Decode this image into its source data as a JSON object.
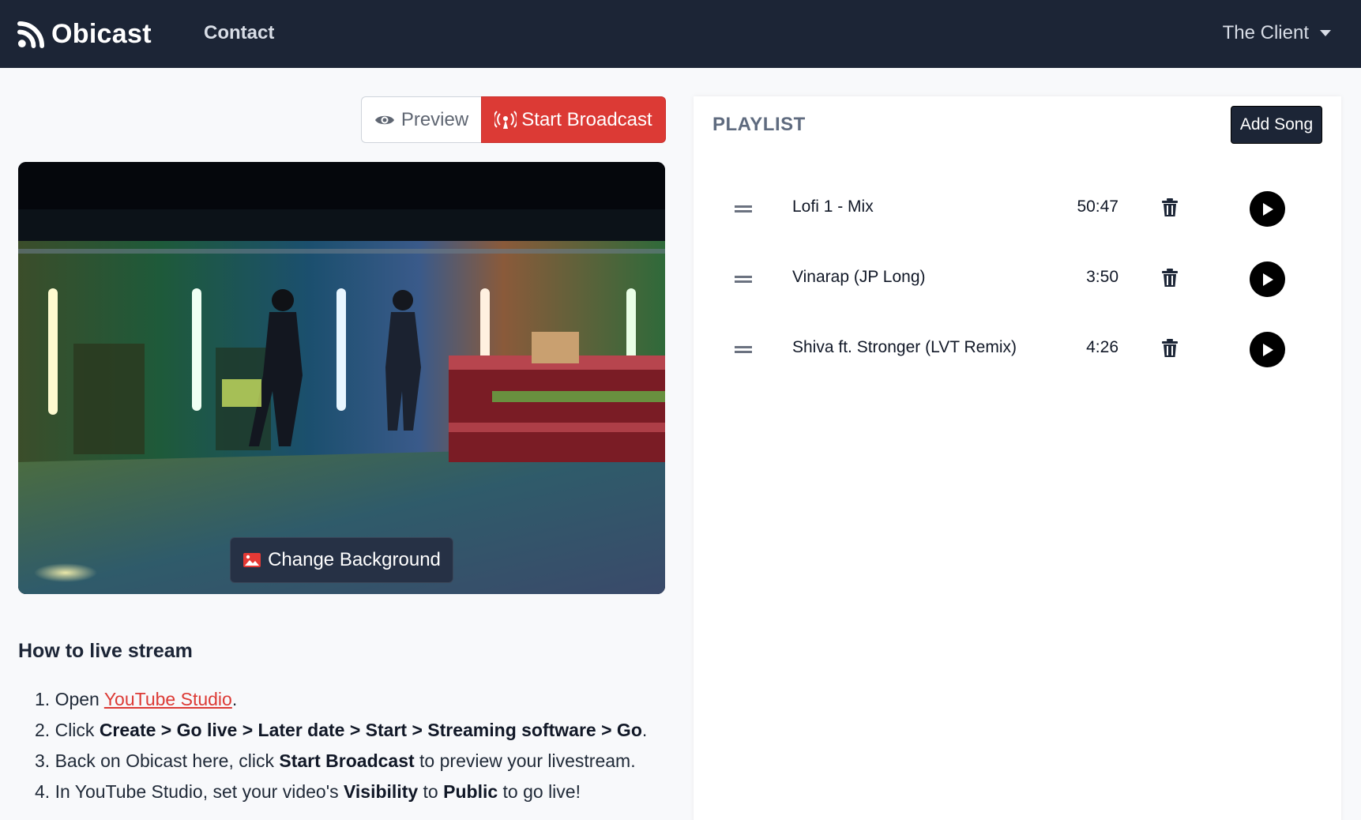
{
  "navbar": {
    "brand": "Obicast",
    "contact_link": "Contact",
    "user_menu": "The Client"
  },
  "controls": {
    "preview_label": "Preview",
    "broadcast_label": "Start Broadcast"
  },
  "background": {
    "change_label": "Change Background"
  },
  "howto": {
    "title": "How to live stream",
    "steps": [
      {
        "num": "1.",
        "open": "Open ",
        "link": "YouTube Studio",
        "end": "."
      },
      {
        "num": "2.",
        "click": "Click ",
        "path": "Create > Go live > Later date > Start > Streaming software > Go",
        "end": "."
      },
      {
        "num": "3.",
        "pre": "Back on Obicast here, click ",
        "bold": "Start Broadcast",
        "post": " to preview your livestream."
      },
      {
        "num": "4.",
        "pre": "In YouTube Studio, set your video's ",
        "bold1": "Visibility",
        "mid": " to ",
        "bold2": "Public",
        "post": " to go live!"
      }
    ]
  },
  "playlist": {
    "title": "PLAYLIST",
    "add_label": "Add Song",
    "songs": [
      {
        "title": "Lofi 1 - Mix",
        "duration": "50:47"
      },
      {
        "title": "Vinarap (JP Long)",
        "duration": "3:50"
      },
      {
        "title": "Shiva ft. Stronger (LVT Remix)",
        "duration": "4:26"
      }
    ]
  },
  "icons": {
    "brand": "rss-icon",
    "preview": "eye-icon",
    "broadcast": "broadcast-tower-icon",
    "change_bg": "image-icon",
    "drag": "drag-handle-icon",
    "delete": "trash-icon",
    "play": "play-icon"
  },
  "colors": {
    "navbar": "#1c2536",
    "accent_red": "#dc3a35",
    "page_bg": "#f8f9fb"
  }
}
